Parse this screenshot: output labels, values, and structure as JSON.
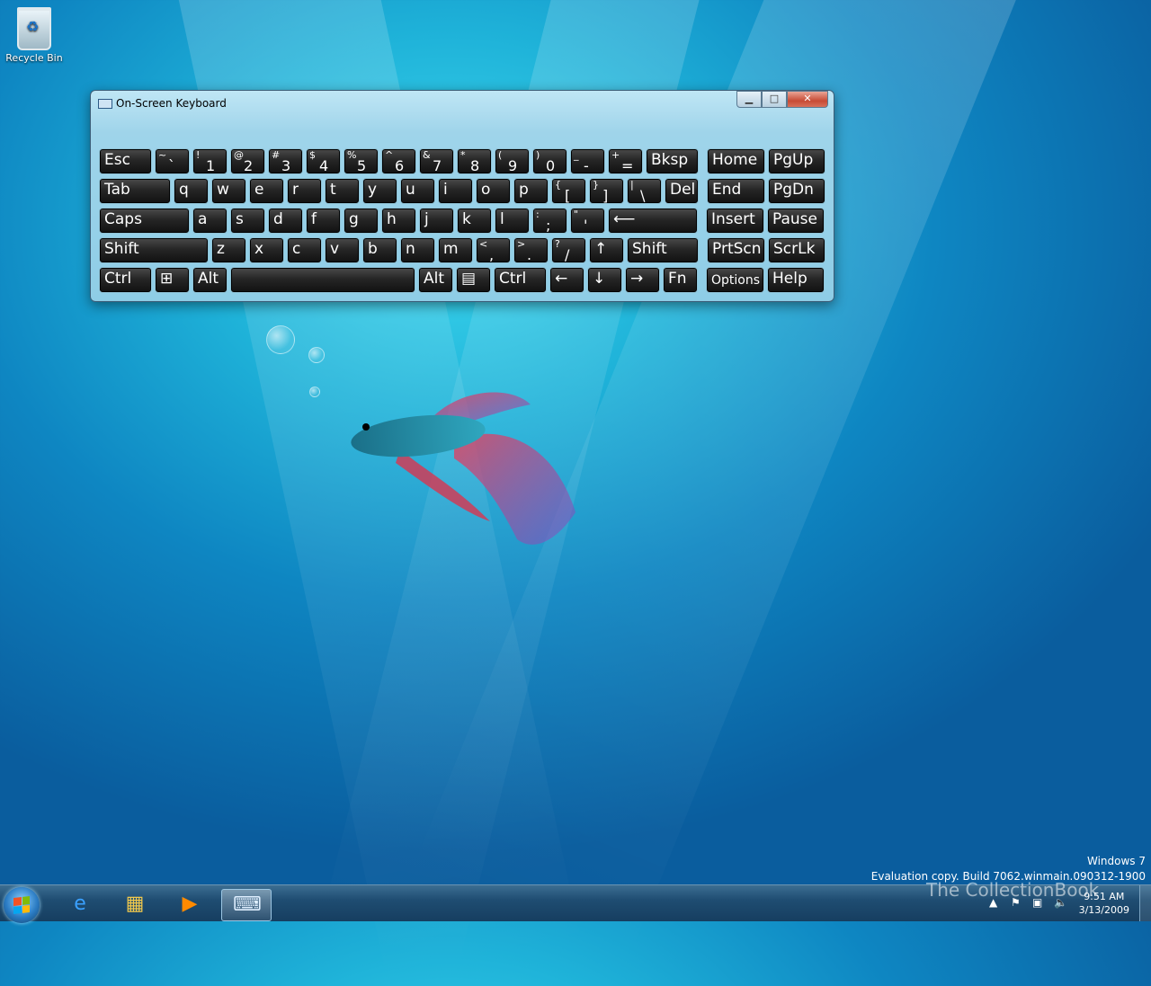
{
  "desktop": {
    "icons": [
      {
        "label": "Recycle Bin",
        "icon": "recycle-bin-icon"
      }
    ]
  },
  "window": {
    "title": "On-Screen Keyboard",
    "buttons": {
      "minimize": "▁",
      "maximize": "□",
      "close": "✕"
    }
  },
  "keyboard": {
    "rows": [
      [
        {
          "main": "Esc"
        },
        {
          "shift": "~",
          "base": "`"
        },
        {
          "shift": "!",
          "base": "1"
        },
        {
          "shift": "@",
          "base": "2"
        },
        {
          "shift": "#",
          "base": "3"
        },
        {
          "shift": "$",
          "base": "4"
        },
        {
          "shift": "%",
          "base": "5"
        },
        {
          "shift": "^",
          "base": "6"
        },
        {
          "shift": "&",
          "base": "7"
        },
        {
          "shift": "*",
          "base": "8"
        },
        {
          "shift": "(",
          "base": "9"
        },
        {
          "shift": ")",
          "base": "0"
        },
        {
          "shift": "_",
          "base": "-"
        },
        {
          "shift": "+",
          "base": "="
        },
        {
          "main": "Bksp"
        },
        {
          "main": "Home"
        },
        {
          "main": "PgUp"
        }
      ],
      [
        {
          "main": "Tab"
        },
        {
          "main": "q"
        },
        {
          "main": "w"
        },
        {
          "main": "e"
        },
        {
          "main": "r"
        },
        {
          "main": "t"
        },
        {
          "main": "y"
        },
        {
          "main": "u"
        },
        {
          "main": "i"
        },
        {
          "main": "o"
        },
        {
          "main": "p"
        },
        {
          "shift": "{",
          "base": "["
        },
        {
          "shift": "}",
          "base": "]"
        },
        {
          "shift": "|",
          "base": "\\"
        },
        {
          "main": "Del"
        },
        {
          "main": "End"
        },
        {
          "main": "PgDn"
        }
      ],
      [
        {
          "main": "Caps"
        },
        {
          "main": "a"
        },
        {
          "main": "s"
        },
        {
          "main": "d"
        },
        {
          "main": "f"
        },
        {
          "main": "g"
        },
        {
          "main": "h"
        },
        {
          "main": "j"
        },
        {
          "main": "k"
        },
        {
          "main": "l"
        },
        {
          "shift": ":",
          "base": ";"
        },
        {
          "shift": "\"",
          "base": "'"
        },
        {
          "main": "⟵"
        },
        {
          "main": "Insert"
        },
        {
          "main": "Pause"
        }
      ],
      [
        {
          "main": "Shift"
        },
        {
          "main": "z"
        },
        {
          "main": "x"
        },
        {
          "main": "c"
        },
        {
          "main": "v"
        },
        {
          "main": "b"
        },
        {
          "main": "n"
        },
        {
          "main": "m"
        },
        {
          "shift": "<",
          "base": ","
        },
        {
          "shift": ">",
          "base": "."
        },
        {
          "shift": "?",
          "base": "/"
        },
        {
          "main": "↑"
        },
        {
          "main": "Shift"
        },
        {
          "main": "PrtScn"
        },
        {
          "main": "ScrLk"
        }
      ],
      [
        {
          "main": "Ctrl"
        },
        {
          "main": "⊞"
        },
        {
          "main": "Alt"
        },
        {
          "main": ""
        },
        {
          "main": "Alt"
        },
        {
          "main": "▤"
        },
        {
          "main": "Ctrl"
        },
        {
          "main": "←"
        },
        {
          "main": "↓"
        },
        {
          "main": "→"
        },
        {
          "main": "Fn"
        },
        {
          "main": "Options"
        },
        {
          "main": "Help"
        }
      ]
    ]
  },
  "watermark": {
    "line1": "Windows 7",
    "line2": "Evaluation copy. Build 7062.winmain.090312-1900"
  },
  "overlay_logo": "The CollectionBook",
  "clock": {
    "time": "9:51 AM",
    "date": "3/13/2009"
  },
  "taskbar": {
    "items": [
      {
        "name": "internet-explorer",
        "glyph": "e",
        "color": "#3aa0ff"
      },
      {
        "name": "windows-explorer",
        "glyph": "▦",
        "color": "#f2c94c"
      },
      {
        "name": "media-player",
        "glyph": "▶",
        "color": "#ff8a00"
      },
      {
        "name": "on-screen-keyboard",
        "glyph": "⌨",
        "color": "#dfefff"
      }
    ]
  }
}
